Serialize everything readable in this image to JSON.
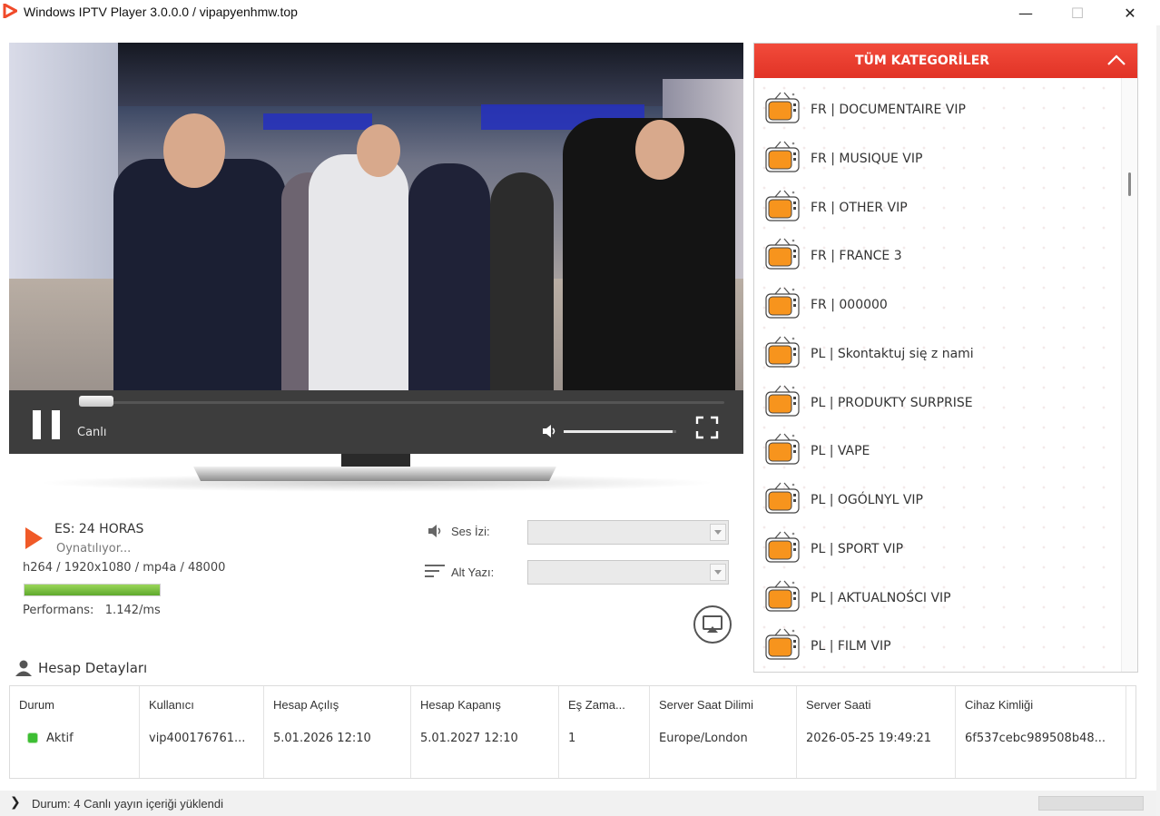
{
  "window": {
    "title": "Windows IPTV Player 3.0.0.0 / vipapyenhmw.top",
    "minimize_glyph": "—",
    "maximize_glyph": "☐",
    "close_glyph": "✕"
  },
  "player": {
    "mode_label": "Canlı",
    "progress": 0.0,
    "volume": 0.97,
    "state": "playing"
  },
  "now_playing": {
    "channel": "ES: 24 HORAS",
    "status": "Oynatılıyor...",
    "codec_info": "h264 / 1920x1080 / mp4a / 48000",
    "performance_fill": 1.0,
    "performance_text": "Performans:   1.142/ms"
  },
  "tracks": {
    "audio_label": "Ses İzi:",
    "audio_value": "",
    "subtitle_label": "Alt Yazı:",
    "subtitle_value": ""
  },
  "account": {
    "title": "Hesap Detayları",
    "columns": [
      {
        "header": "Durum",
        "value": "Aktif"
      },
      {
        "header": "Kullanıcı",
        "value": "vip400176761..."
      },
      {
        "header": "Hesap Açılış",
        "value": "5.01.2026 12:10"
      },
      {
        "header": "Hesap Kapanış",
        "value": "5.01.2027 12:10"
      },
      {
        "header": "Eş Zama...",
        "value": "1"
      },
      {
        "header": "Server Saat Dilimi",
        "value": "Europe/London"
      },
      {
        "header": "Server Saati",
        "value": "2026-05-25 19:49:21"
      },
      {
        "header": "Cihaz Kimliği",
        "value": "6f537cebc989508b48..."
      }
    ]
  },
  "statusbar": {
    "message": "Durum: 4 Canlı yayın içeriği yüklendi",
    "chevron": "❯"
  },
  "categories": {
    "header": "TÜM KATEGORİLER",
    "items": [
      "FR | DOCUMENTAIRE VIP",
      "FR | MUSIQUE VIP",
      "FR | OTHER VIP",
      "FR | FRANCE 3",
      "FR | 000000",
      "PL | Skontaktuj się z nami",
      "PL | PRODUKTY SURPRISE",
      "PL | VAPE",
      "PL | OGÓLNYL VIP",
      "PL | SPORT VIP",
      "PL | AKTUALNOŚCI VIP",
      "PL | FILM VIP"
    ]
  },
  "colors": {
    "accent": "#e13326",
    "tv_icon_orange": "#f7941d",
    "status_active": "#3dbe33",
    "player_controls": "#3d3d3d"
  },
  "icons": {
    "app": "play-triangle-icon",
    "volume": "speaker-icon",
    "fullscreen": "fullscreen-icon",
    "account": "user-icon",
    "cast": "cast-icon",
    "category": "tv-icon",
    "subtitle": "lines-icon"
  }
}
